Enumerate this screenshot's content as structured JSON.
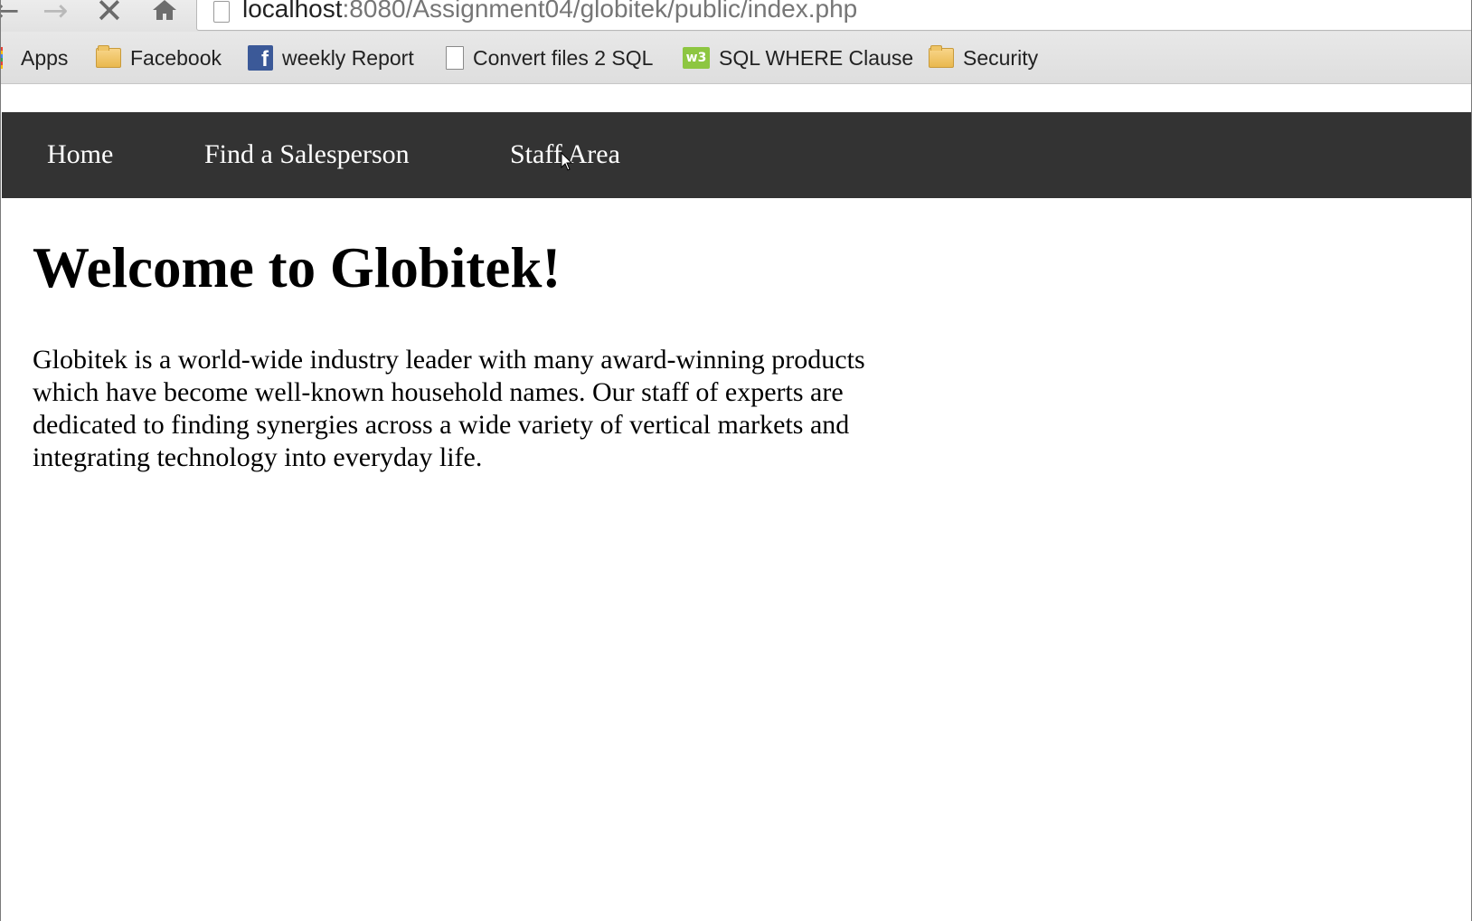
{
  "browser": {
    "url_host": "localhost",
    "url_path": ":8080/Assignment04/globitek/public/index.php",
    "bookmarks": [
      {
        "label": "Apps",
        "icon": "apps-grid-icon"
      },
      {
        "label": "Facebook",
        "icon": "folder-icon"
      },
      {
        "label": "weekly Report",
        "icon": "facebook-icon"
      },
      {
        "label": "Convert files 2 SQL",
        "icon": "document-icon"
      },
      {
        "label": "SQL WHERE Clause",
        "icon": "w3schools-icon"
      },
      {
        "label": "Security",
        "icon": "folder-icon"
      }
    ]
  },
  "site": {
    "nav": {
      "home": "Home",
      "find": "Find a Salesperson",
      "staff": "Staff Area"
    },
    "heading": "Welcome to Globitek!",
    "intro": "Globitek is a world-wide industry leader with many award-winning products which have become well-known household names. Our staff of experts are dedicated to finding synergies across a wide variety of vertical markets and integrating technology into everyday life."
  },
  "colors": {
    "nav_background": "#333333",
    "nav_text": "#ffffff",
    "folder": "#f3c96b",
    "facebook": "#3b5998",
    "w3schools": "#8dc641"
  }
}
